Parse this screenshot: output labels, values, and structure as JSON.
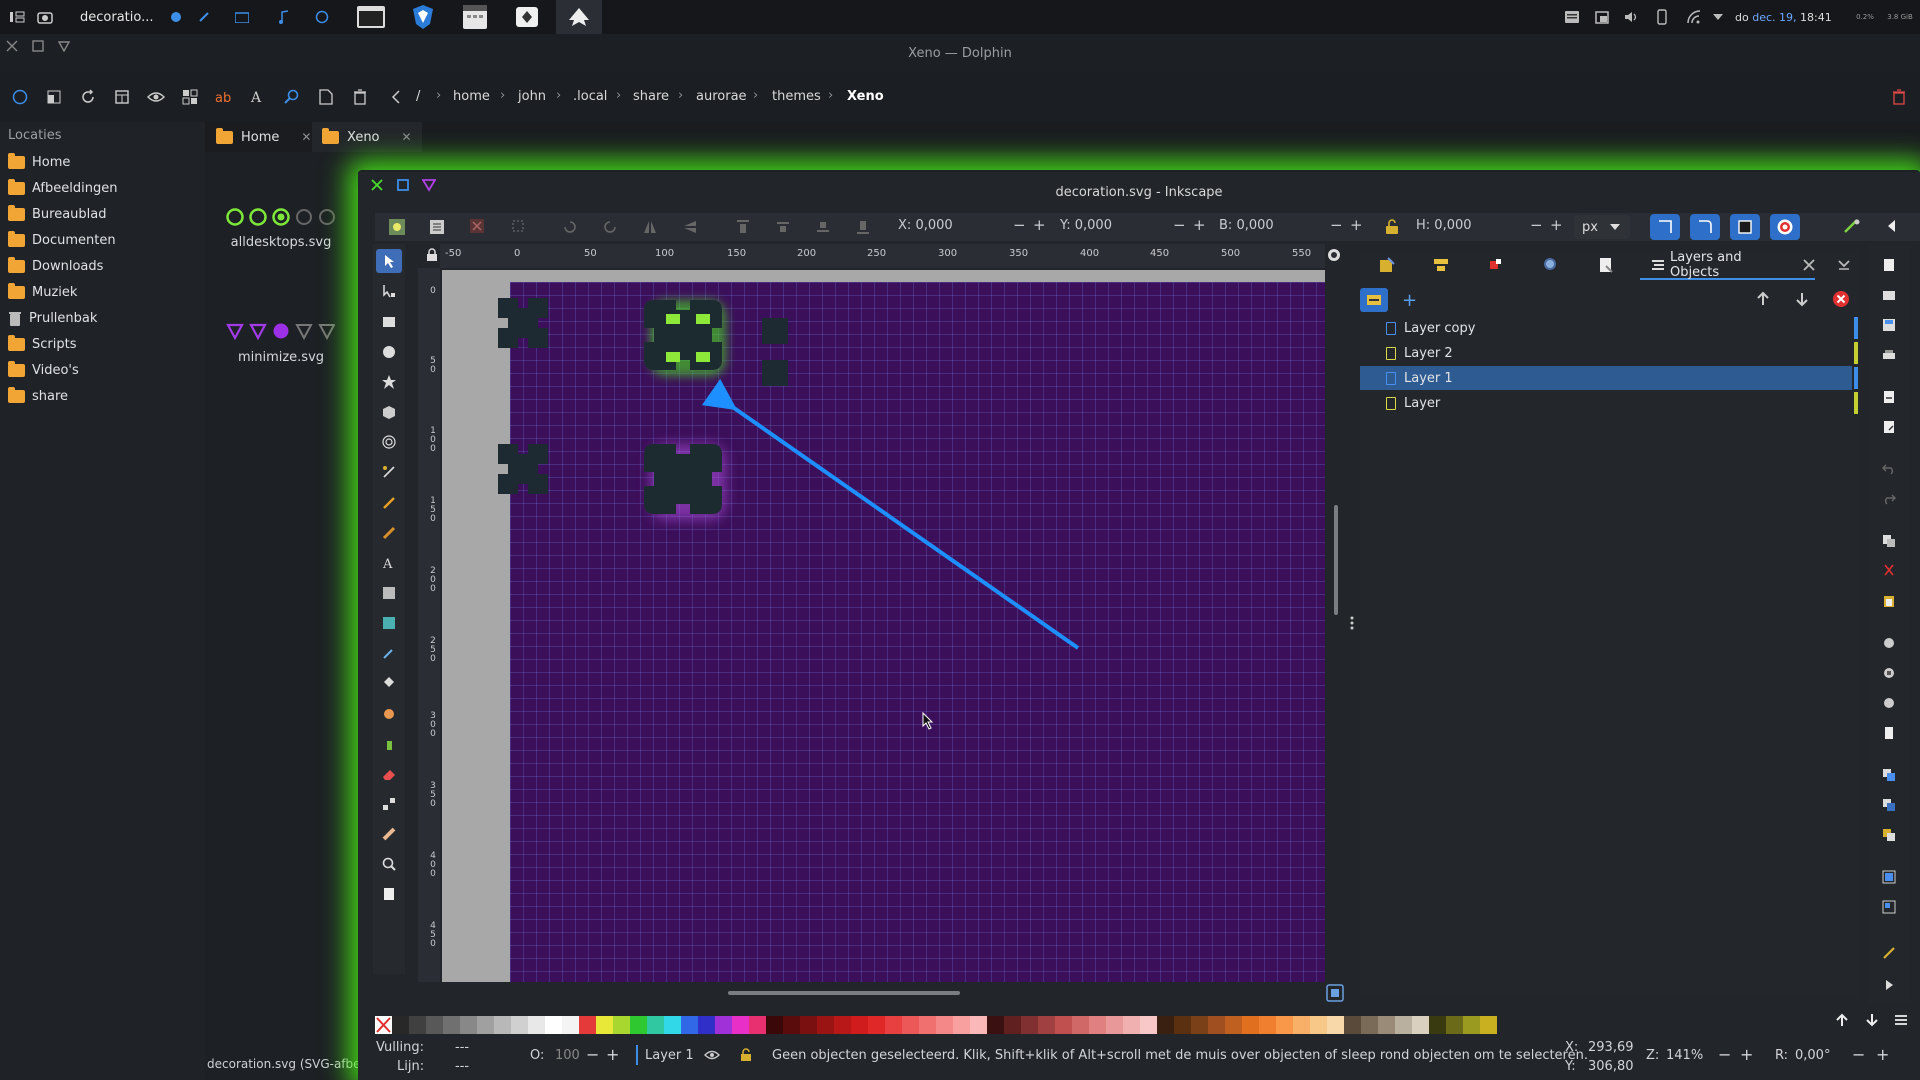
{
  "panel": {
    "active_window_label": "decoratio...",
    "date_prefix": "do",
    "date_day": "dec. 19,",
    "time": "18:41",
    "cpu_meter": "0.2%",
    "mem_meter": "3.8 GiB"
  },
  "dolphin": {
    "title": "Xeno — Dolphin",
    "breadcrumb": [
      "/",
      "home",
      "john",
      ".local",
      "share",
      "aurorae",
      "themes",
      "Xeno"
    ],
    "places_title": "Locaties",
    "places": [
      "Home",
      "Afbeeldingen",
      "Bureaublad",
      "Documenten",
      "Downloads",
      "Muziek",
      "Prullenbak",
      "Scripts",
      "Video's",
      "share"
    ],
    "tabs": [
      "Home",
      "Xeno"
    ],
    "files": [
      "alldesktops.svg",
      "minimize.svg"
    ],
    "status": "decoration.svg (SVG-afbe"
  },
  "inkscape": {
    "title": "decoration.svg - Inkscape",
    "toolbar": {
      "x_label": "X:",
      "x_value": "0,000",
      "y_label": "Y:",
      "y_value": "0,000",
      "w_label": "B:",
      "w_value": "0,000",
      "h_label": "H:",
      "h_value": "0,000",
      "unit": "px"
    },
    "ruler_h": [
      "-50",
      "0",
      "50",
      "100",
      "150",
      "200",
      "250",
      "300",
      "350",
      "400",
      "450",
      "500",
      "550"
    ],
    "ruler_v": [
      "0",
      "50",
      "100",
      "150",
      "200",
      "250",
      "300",
      "350",
      "400",
      "450"
    ],
    "dock_tab": "Layers and Objects",
    "layers": [
      {
        "name": "Layer copy",
        "color": "#3d8ee8",
        "icon_color": "#4a8ff0"
      },
      {
        "name": "Layer 2",
        "color": "#c4d032",
        "icon_color": "#d9d94a"
      },
      {
        "name": "Layer 1",
        "color": "#3d8ee8",
        "icon_color": "#4a8ff0",
        "selected": true
      },
      {
        "name": "Layer",
        "color": "#c4d032",
        "icon_color": "#d9d94a"
      }
    ],
    "status": {
      "fill_label": "Vulling:",
      "fill_value": "---",
      "stroke_label": "Lijn:",
      "stroke_value": "---",
      "opacity_label": "O:",
      "opacity_value": "100",
      "current_layer": "Layer 1",
      "message": "Geen objecten geselecteerd. Klik, Shift+klik of Alt+scroll met de muis over objecten of sleep rond objecten om te selecteren.",
      "cursor_x_label": "X:",
      "cursor_x": "293,69",
      "cursor_y_label": "Y:",
      "cursor_y": "306,80",
      "zoom_label": "Z:",
      "zoom": "141%",
      "rotate_label": "R:",
      "rotate": "0,00°"
    }
  },
  "colors": {
    "accent_blue": "#3d8ee8",
    "glow_green": "#46f014",
    "canvas_purple": "#3c0f5a",
    "arrow_blue": "#1e8fff"
  }
}
